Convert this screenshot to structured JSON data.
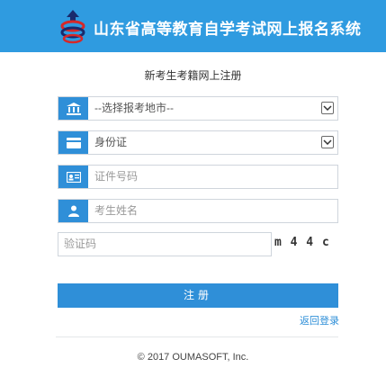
{
  "header": {
    "title": "山东省高等教育自学考试网上报名系统"
  },
  "form": {
    "title": "新考生考籍网上注册",
    "region_select": {
      "value": "--选择报考地市--",
      "icon": "bank-icon"
    },
    "id_type_select": {
      "value": "身份证",
      "icon": "card-icon"
    },
    "id_number": {
      "placeholder": "证件号码",
      "icon": "id-card-icon"
    },
    "name": {
      "placeholder": "考生姓名",
      "icon": "user-icon"
    },
    "captcha": {
      "placeholder": "验证码",
      "image_text": "m 4 4 c"
    },
    "submit_label": "注册",
    "back_link": "返回登录"
  },
  "footer": {
    "copyright": "© 2017 OUMASOFT, Inc."
  },
  "colors": {
    "header_bg": "#2f9be0",
    "accent": "#2f8fd8"
  }
}
